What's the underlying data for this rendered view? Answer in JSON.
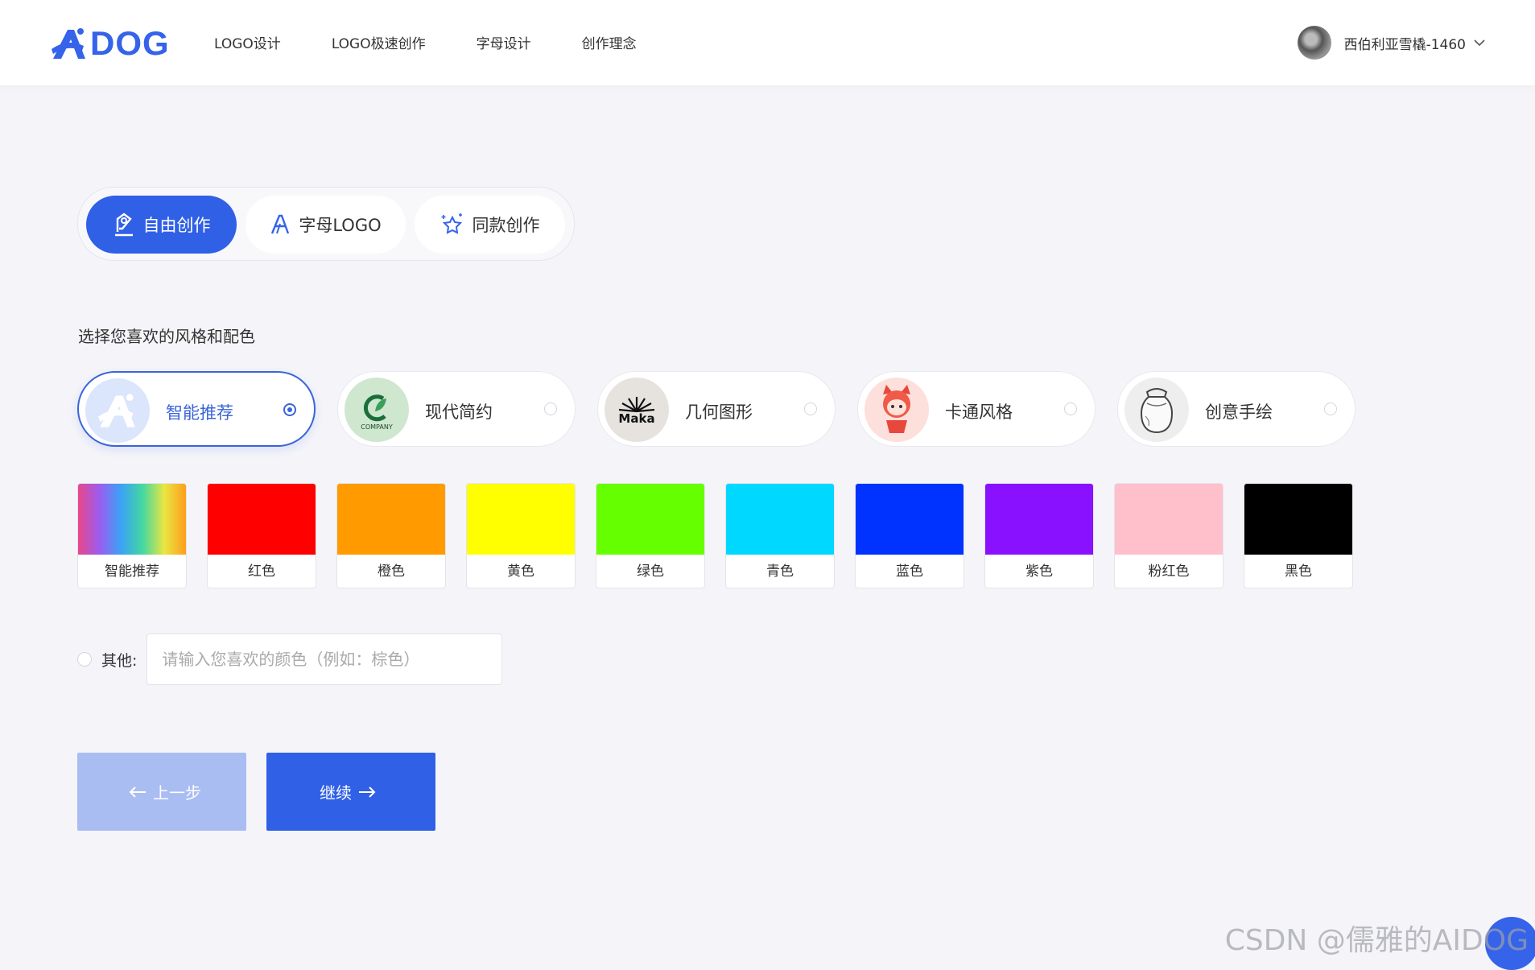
{
  "header": {
    "logo_text": "DOG",
    "nav": [
      "LOGO设计",
      "LOGO极速创作",
      "字母设计",
      "创作理念"
    ],
    "user_name": "西伯利亚雪橇-1460"
  },
  "modes": [
    {
      "label": "自由创作",
      "icon": "pen-icon",
      "active": true
    },
    {
      "label": "字母LOGO",
      "icon": "letter-a-icon",
      "active": false
    },
    {
      "label": "同款创作",
      "icon": "sparkle-star-icon",
      "active": false
    }
  ],
  "section_label": "选择您喜欢的风格和配色",
  "styles": [
    {
      "label": "智能推荐",
      "selected": true
    },
    {
      "label": "现代简约",
      "thumb_text": "COMPANY",
      "selected": false
    },
    {
      "label": "几何图形",
      "thumb_text": "Maka",
      "selected": false
    },
    {
      "label": "卡通风格",
      "selected": false
    },
    {
      "label": "创意手绘",
      "selected": false
    }
  ],
  "colors": [
    {
      "label": "智能推荐",
      "color": "rainbow"
    },
    {
      "label": "红色",
      "color": "#ff0000"
    },
    {
      "label": "橙色",
      "color": "#ff9a00"
    },
    {
      "label": "黄色",
      "color": "#ffff00"
    },
    {
      "label": "绿色",
      "color": "#66ff00"
    },
    {
      "label": "青色",
      "color": "#00d8ff"
    },
    {
      "label": "蓝色",
      "color": "#0033ff"
    },
    {
      "label": "紫色",
      "color": "#8a11ff"
    },
    {
      "label": "粉红色",
      "color": "#ffc0cb"
    },
    {
      "label": "黑色",
      "color": "#000000"
    }
  ],
  "other": {
    "label": "其他:",
    "placeholder": "请输入您喜欢的颜色（例如：棕色）"
  },
  "buttons": {
    "prev": "上一步",
    "next": "继续"
  },
  "watermark": "CSDN @儒雅的AIDOG",
  "accent": "#3060e6"
}
